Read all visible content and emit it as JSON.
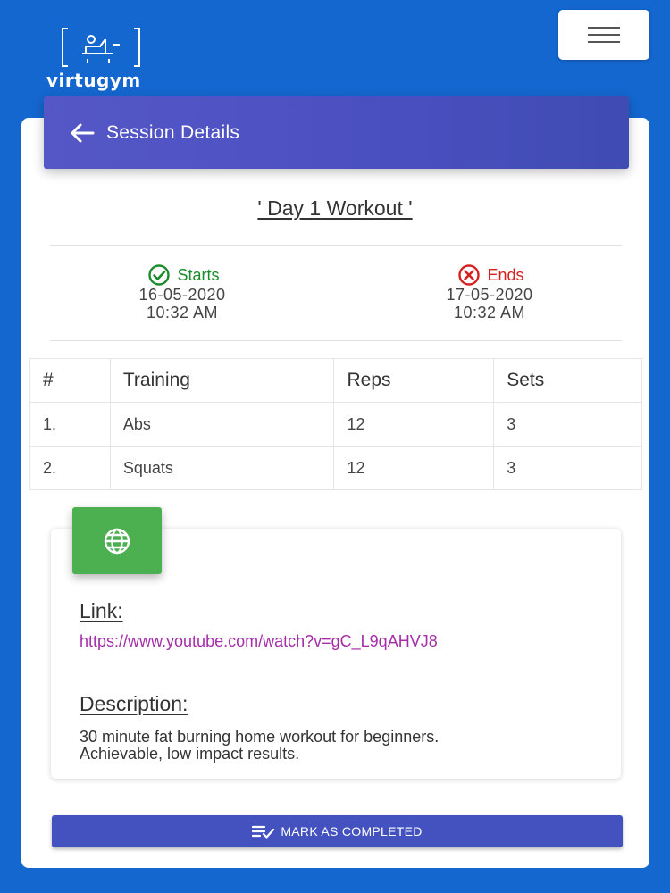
{
  "app": {
    "logo_text": "virtugym"
  },
  "header": {
    "title": "Session Details"
  },
  "workout": {
    "title": "' Day 1 Workout '"
  },
  "schedule": {
    "starts": {
      "label": "Starts",
      "date": "16-05-2020",
      "time": "10:32 AM"
    },
    "ends": {
      "label": "Ends",
      "date": "17-05-2020",
      "time": "10:32 AM"
    }
  },
  "table": {
    "headers": [
      "#",
      "Training",
      "Reps",
      "Sets"
    ],
    "rows": [
      [
        "1.",
        "Abs",
        "12",
        "3"
      ],
      [
        "2.",
        "Squats",
        "12",
        "3"
      ]
    ]
  },
  "details": {
    "link_label": "Link:",
    "link_url": "https://www.youtube.com/watch?v=gC_L9qAHVJ8",
    "description_label": "Description:",
    "description_line1": "30 minute fat burning home workout for beginners.",
    "description_line2": "Achievable, low impact results."
  },
  "actions": {
    "mark_completed": "MARK AS COMPLETED"
  },
  "icons": {
    "menu": "hamburger-icon",
    "back": "arrow-left-icon",
    "starts": "check-circle-icon",
    "ends": "x-circle-icon",
    "globe": "globe-icon",
    "complete": "playlist-check-icon"
  },
  "colors": {
    "background": "#1467cf",
    "header": "#4a4fc0",
    "starts": "#1a8a2b",
    "ends": "#d62020",
    "globe_button": "#4caf50",
    "link": "#a52da8",
    "primary_button": "#4452c0"
  }
}
